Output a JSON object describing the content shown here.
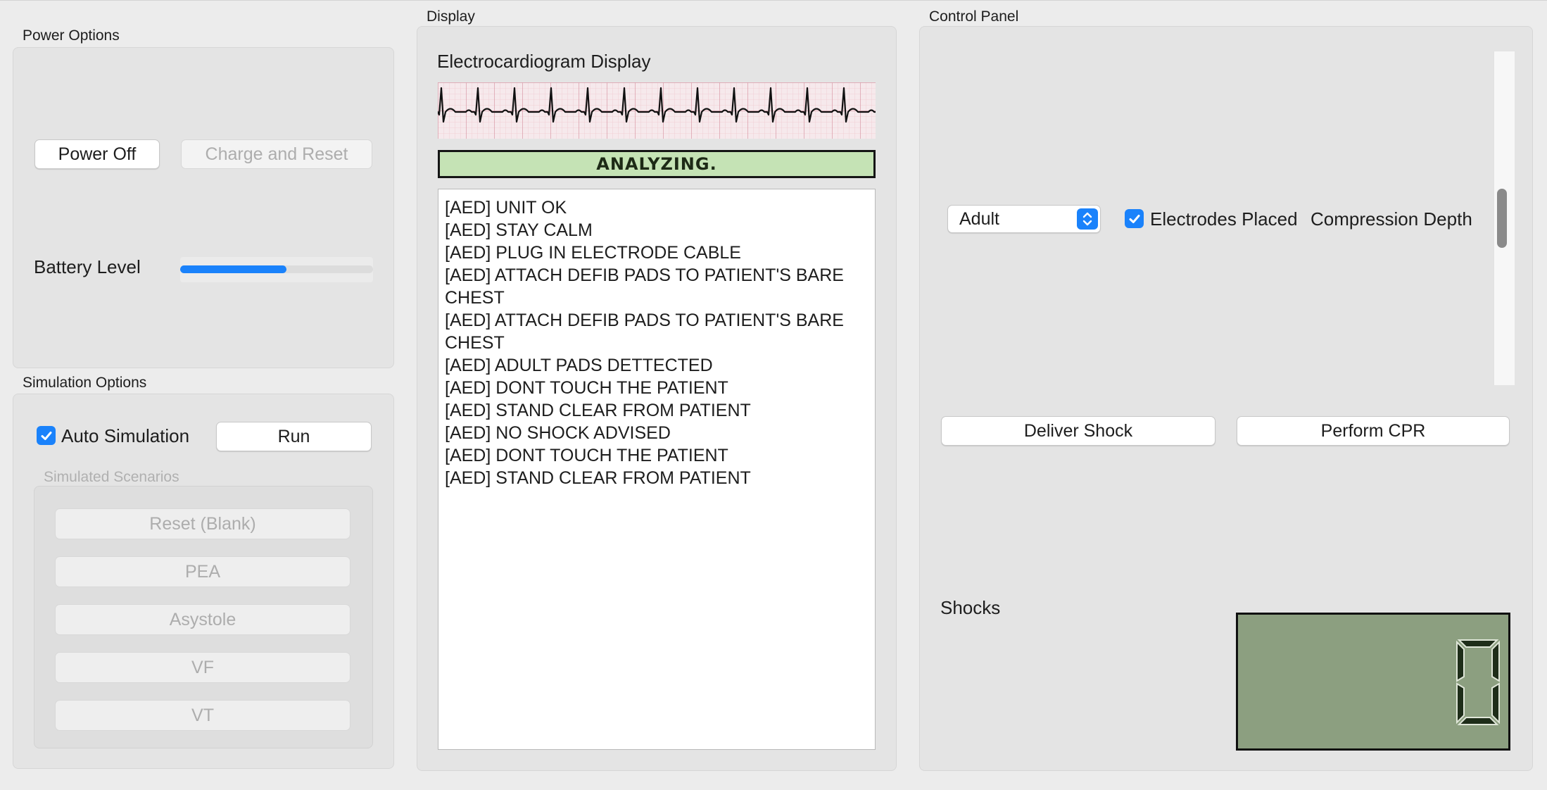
{
  "power_options": {
    "title": "Power Options",
    "power_off_label": "Power Off",
    "charge_reset_label": "Charge and Reset",
    "battery_label": "Battery Level",
    "battery_fraction": 0.55
  },
  "simulation_options": {
    "title": "Simulation Options",
    "auto_simulation_label": "Auto Simulation",
    "auto_simulation_checked": true,
    "run_label": "Run",
    "scenarios_title": "Simulated Scenarios",
    "scenarios": [
      "Reset (Blank)",
      "PEA",
      "Asystole",
      "VF",
      "VT"
    ]
  },
  "display": {
    "title": "Display",
    "ecg_title": "Electrocardiogram Display",
    "status_text": "ANALYZING.",
    "status_color": "#c5e3b5",
    "log_lines": [
      "[AED] UNIT OK",
      "[AED] STAY CALM",
      "[AED] PLUG IN ELECTRODE CABLE",
      "[AED] ATTACH DEFIB PADS TO PATIENT'S BARE CHEST",
      "[AED] ATTACH DEFIB PADS TO PATIENT'S BARE CHEST",
      "[AED] ADULT PADS DETTECTED",
      "[AED] DONT TOUCH THE PATIENT",
      "[AED] STAND CLEAR FROM PATIENT",
      "[AED] NO SHOCK ADVISED",
      "[AED] DONT TOUCH THE PATIENT",
      "[AED] STAND CLEAR FROM PATIENT"
    ]
  },
  "control_panel": {
    "title": "Control Panel",
    "patient_type_selected": "Adult",
    "electrodes_label": "Electrodes Placed",
    "electrodes_checked": true,
    "compression_label": "Compression Depth",
    "deliver_shock_label": "Deliver Shock",
    "perform_cpr_label": "Perform CPR",
    "shocks_label": "Shocks",
    "shocks_display_color": "#8c9f80",
    "accent_color": "#1a82fb"
  }
}
